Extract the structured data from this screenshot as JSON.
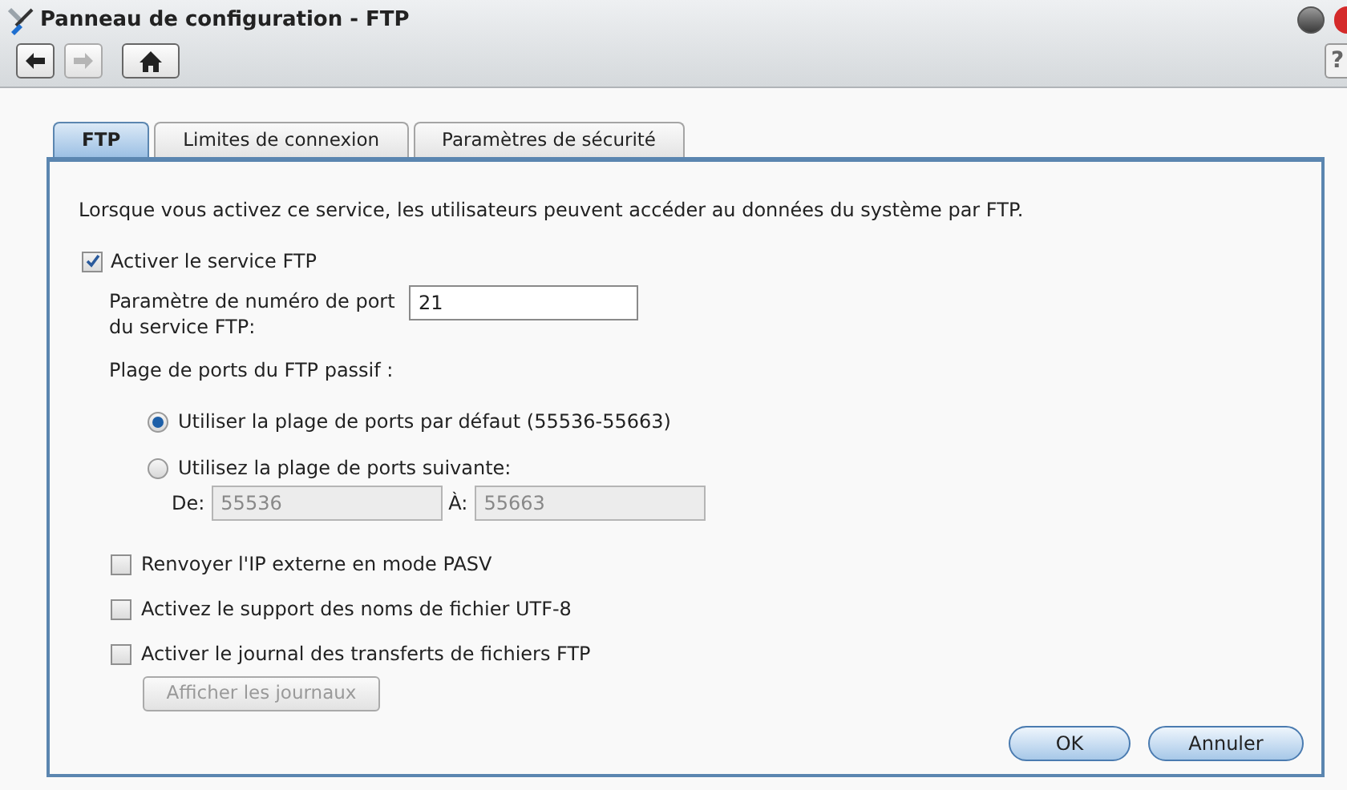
{
  "window": {
    "title": "Panneau de configuration - FTP"
  },
  "toolbar": {
    "buttons": [
      {
        "kind": "back",
        "disabled": false
      },
      {
        "kind": "forward",
        "disabled": true
      },
      {
        "kind": "home",
        "disabled": false
      }
    ],
    "help": "?"
  },
  "tabs": [
    {
      "label": "FTP",
      "selected": true
    },
    {
      "label": "Limites de connexion",
      "selected": false
    },
    {
      "label": "Paramètres de sécurité",
      "selected": false
    }
  ],
  "description": "Lorsque vous activez ce service, les utilisateurs peuvent accéder au données du système par FTP.",
  "enable_service": {
    "label": "Activer le service FTP",
    "checked": true
  },
  "port": {
    "label": "Paramètre de numéro de port du service FTP:",
    "value": "21"
  },
  "passive_range": {
    "label": "Plage de ports du FTP passif :",
    "options": [
      {
        "label": "Utiliser la plage de ports par défaut (55536-55663)",
        "selected": true
      },
      {
        "label": "Utilisez la plage de ports suivante:",
        "selected": false
      }
    ],
    "from": {
      "label": "De:",
      "value": "55536",
      "disabled": true
    },
    "to": {
      "label": "À:",
      "value": "55663",
      "disabled": true
    }
  },
  "options": [
    {
      "label": "Renvoyer l'IP externe en mode PASV",
      "checked": false
    },
    {
      "label": "Activez le support des noms de fichier UTF-8",
      "checked": false
    },
    {
      "label": "Activer le journal des transferts de fichiers FTP",
      "checked": false
    }
  ],
  "log_button": {
    "label": "Afficher les journaux",
    "disabled": true
  },
  "buttons": [
    {
      "label": "OK"
    },
    {
      "label": "Annuler"
    }
  ]
}
